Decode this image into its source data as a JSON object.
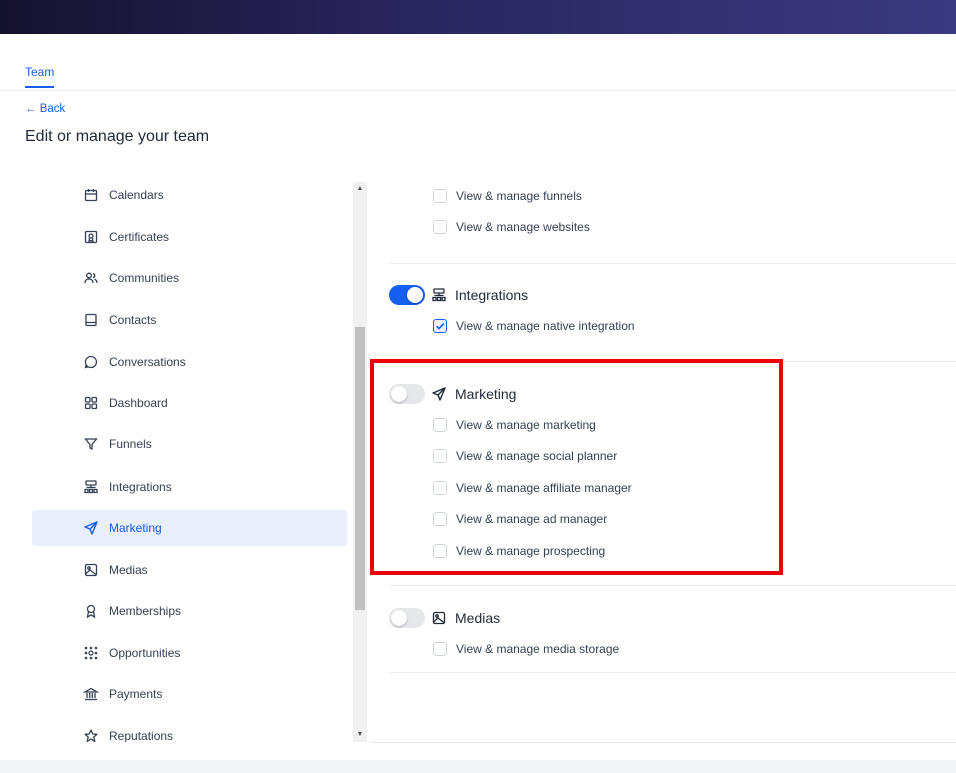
{
  "header": {
    "tab": "Team",
    "back": "← Back",
    "title": "Edit or manage your team"
  },
  "sidebar": {
    "items": [
      {
        "label": "Calendars",
        "icon": "calendar-icon"
      },
      {
        "label": "Certificates",
        "icon": "certificate-icon"
      },
      {
        "label": "Communities",
        "icon": "users-icon"
      },
      {
        "label": "Contacts",
        "icon": "book-icon"
      },
      {
        "label": "Conversations",
        "icon": "chat-bubble-icon"
      },
      {
        "label": "Dashboard",
        "icon": "grid-icon"
      },
      {
        "label": "Funnels",
        "icon": "filter-icon"
      },
      {
        "label": "Integrations",
        "icon": "sitemap-icon"
      },
      {
        "label": "Marketing",
        "icon": "send-icon",
        "active": true
      },
      {
        "label": "Medias",
        "icon": "image-icon"
      },
      {
        "label": "Memberships",
        "icon": "award-icon"
      },
      {
        "label": "Opportunities",
        "icon": "nodes-icon"
      },
      {
        "label": "Payments",
        "icon": "bank-icon"
      },
      {
        "label": "Reputations",
        "icon": "star-icon"
      }
    ]
  },
  "sections": {
    "funnels": {
      "perms": [
        {
          "label": "View & manage funnels",
          "checked": false
        },
        {
          "label": "View & manage websites",
          "checked": false
        }
      ]
    },
    "integrations": {
      "title": "Integrations",
      "enabled": true,
      "perms": [
        {
          "label": "View & manage native integration",
          "checked": true
        }
      ]
    },
    "marketing": {
      "title": "Marketing",
      "enabled": false,
      "perms": [
        {
          "label": "View & manage marketing",
          "checked": false
        },
        {
          "label": "View & manage social planner",
          "checked": false
        },
        {
          "label": "View & manage affiliate manager",
          "checked": false
        },
        {
          "label": "View & manage ad manager",
          "checked": false
        },
        {
          "label": "View & manage prospecting",
          "checked": false
        }
      ]
    },
    "medias": {
      "title": "Medias",
      "enabled": false,
      "perms": [
        {
          "label": "View & manage media storage",
          "checked": false
        }
      ]
    }
  },
  "colors": {
    "accent": "#155eef",
    "highlight": "#ee0000"
  }
}
